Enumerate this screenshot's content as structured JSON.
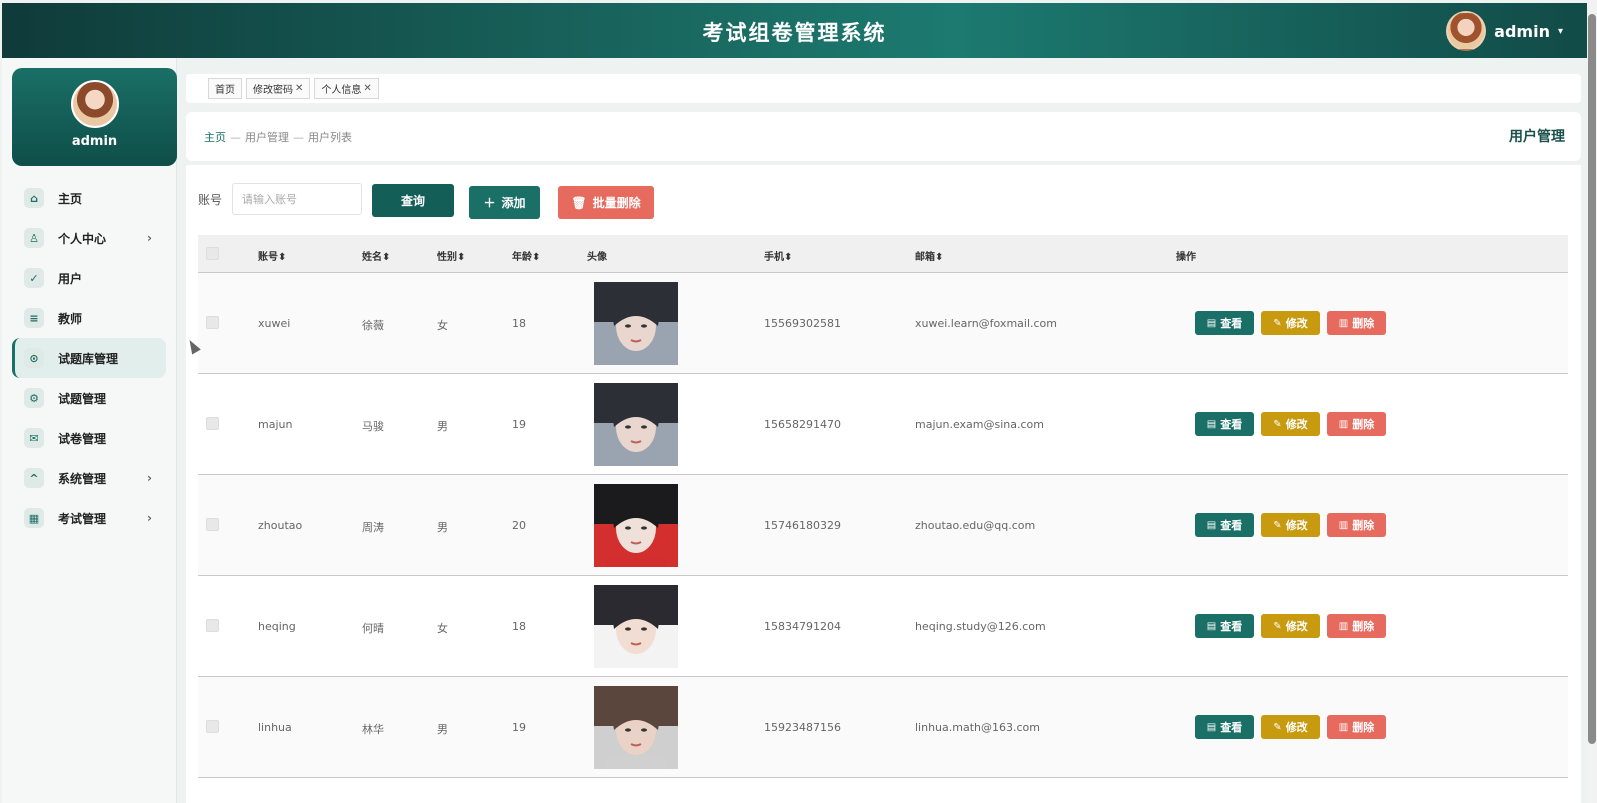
{
  "app": {
    "title": "考试组卷管理系统",
    "user": "admin"
  },
  "sidebar": {
    "profile_name": "admin",
    "items": [
      {
        "label": "主页",
        "icon": "home-icon",
        "glyph": "⌂",
        "arrow": false
      },
      {
        "label": "个人中心",
        "icon": "person-icon",
        "glyph": "♙",
        "arrow": true
      },
      {
        "label": "用户",
        "icon": "check-icon",
        "glyph": "✓",
        "arrow": false
      },
      {
        "label": "教师",
        "icon": "list-icon",
        "glyph": "≡",
        "arrow": false
      },
      {
        "label": "试题库管理",
        "icon": "circle-check-icon",
        "glyph": "⊙",
        "arrow": false,
        "active": true
      },
      {
        "label": "试题管理",
        "icon": "gear-icon",
        "glyph": "⚙",
        "arrow": false
      },
      {
        "label": "试卷管理",
        "icon": "paper-icon",
        "glyph": "✉",
        "arrow": false
      },
      {
        "label": "系统管理",
        "icon": "chevron-up-icon",
        "glyph": "^",
        "arrow": true
      },
      {
        "label": "考试管理",
        "icon": "grid-icon",
        "glyph": "▦",
        "arrow": true
      }
    ]
  },
  "tabs": [
    {
      "label": "首页",
      "closable": false
    },
    {
      "label": "修改密码",
      "closable": true
    },
    {
      "label": "个人信息",
      "closable": true
    }
  ],
  "breadcrumb": {
    "home": "主页",
    "level2": "用户管理",
    "level3": "用户列表",
    "sep": "—",
    "page_title": "用户管理"
  },
  "search": {
    "label": "账号",
    "placeholder": "请输入账号",
    "query": "查询",
    "add": "添加",
    "bulk_delete": "批量删除"
  },
  "table": {
    "headers": {
      "account": "账号",
      "name": "姓名",
      "gender": "性别",
      "age": "年龄",
      "avatar": "头像",
      "phone": "手机",
      "email": "邮箱",
      "ops": "操作"
    },
    "ops": {
      "view": "查看",
      "edit": "修改",
      "delete": "删除"
    },
    "rows": [
      {
        "account": "xuwei",
        "name": "徐薇",
        "gender": "女",
        "age": "18",
        "phone": "15569302581",
        "email": "xuwei.learn@foxmail.com",
        "avatar_colors": [
          "#2c2f36",
          "#e8d6cf",
          "#9aa3b0"
        ]
      },
      {
        "account": "majun",
        "name": "马骏",
        "gender": "男",
        "age": "19",
        "phone": "15658291470",
        "email": "majun.exam@sina.com",
        "avatar_colors": [
          "#2c2f36",
          "#e8d6cf",
          "#9aa3b0"
        ]
      },
      {
        "account": "zhoutao",
        "name": "周涛",
        "gender": "男",
        "age": "20",
        "phone": "15746180329",
        "email": "zhoutao.edu@qq.com",
        "avatar_colors": [
          "#1b1b1e",
          "#efe1da",
          "#d32f2f"
        ]
      },
      {
        "account": "heqing",
        "name": "何晴",
        "gender": "女",
        "age": "18",
        "phone": "15834791204",
        "email": "heqing.study@126.com",
        "avatar_colors": [
          "#2a2a30",
          "#f1ddd2",
          "#f3f3f3"
        ]
      },
      {
        "account": "linhua",
        "name": "林华",
        "gender": "男",
        "age": "19",
        "phone": "15923487156",
        "email": "linhua.math@163.com",
        "avatar_colors": [
          "#5a463c",
          "#ead3c6",
          "#cfcfcf"
        ]
      }
    ]
  }
}
